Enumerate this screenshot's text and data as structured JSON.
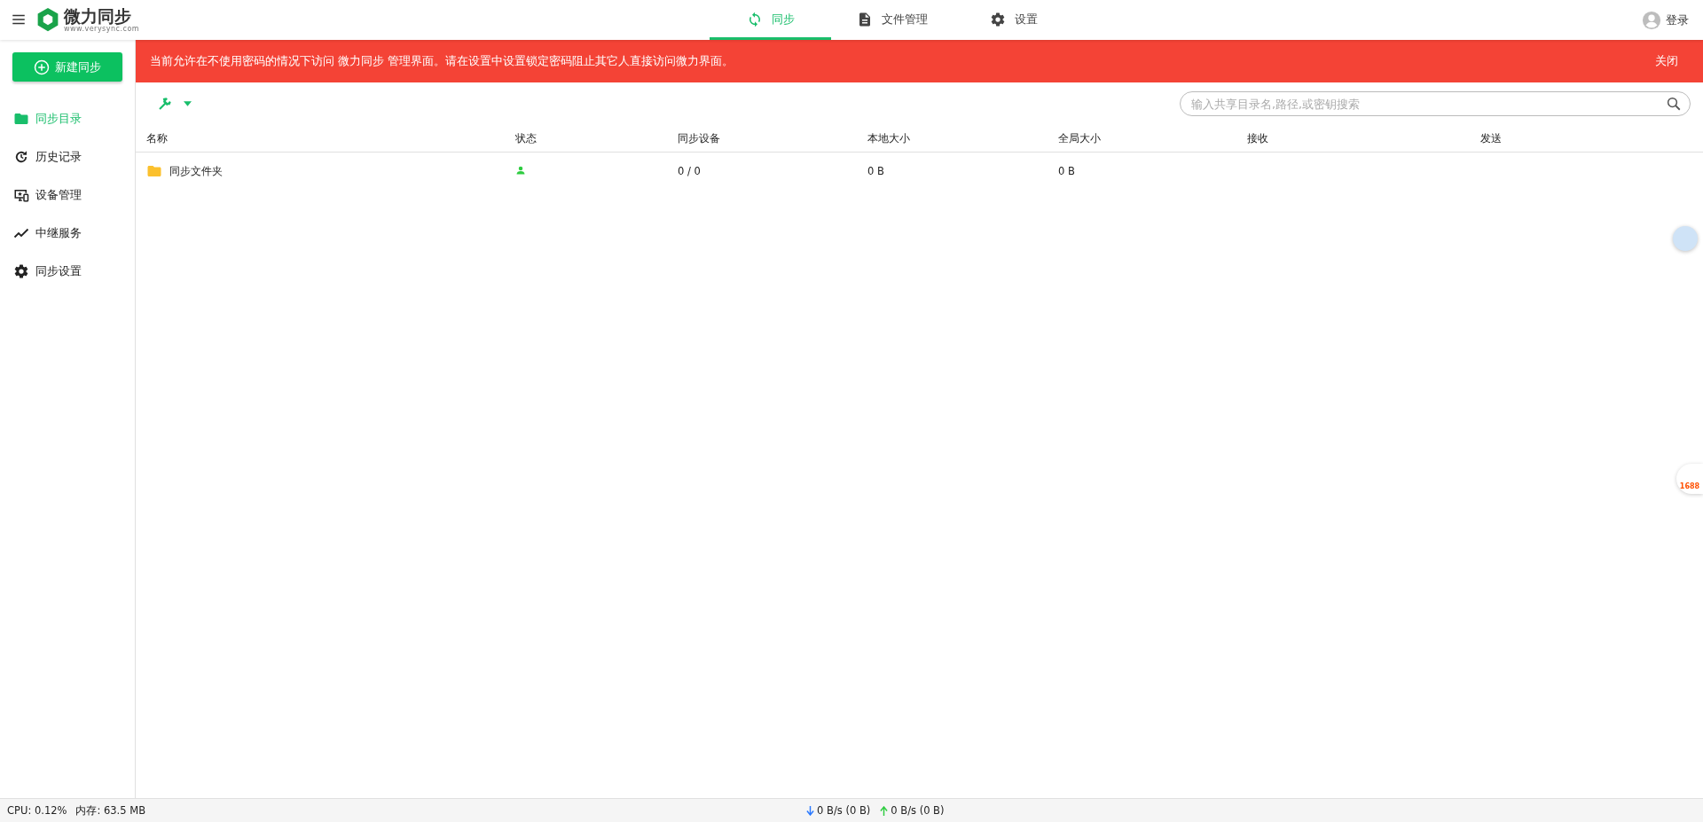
{
  "header": {
    "logo": {
      "name": "微力同步",
      "url": "www.verysync.com"
    },
    "tabs": [
      {
        "label": "同步",
        "selected": true
      },
      {
        "label": "文件管理",
        "selected": false
      },
      {
        "label": "设置",
        "selected": false
      }
    ],
    "login": "登录"
  },
  "sidebar": {
    "new_button": "新建同步",
    "items": [
      {
        "label": "同步目录",
        "selected": true
      },
      {
        "label": "历史记录",
        "selected": false
      },
      {
        "label": "设备管理",
        "selected": false
      },
      {
        "label": "中继服务",
        "selected": false
      },
      {
        "label": "同步设置",
        "selected": false
      }
    ]
  },
  "banner": {
    "message": "当前允许在不使用密码的情况下访问 微力同步 管理界面。请在设置中设置锁定密码阻止其它人直接访问微力界面。",
    "close": "关闭"
  },
  "search": {
    "placeholder": "输入共享目录名,路径,或密钥搜索"
  },
  "table": {
    "columns": [
      "名称",
      "状态",
      "同步设备",
      "本地大小",
      "全局大小",
      "接收",
      "发送"
    ],
    "rows": [
      {
        "name": "同步文件夹",
        "online": true,
        "devices": "0 / 0",
        "local_size": "0 B",
        "global_size": "0 B"
      }
    ]
  },
  "floating": {
    "badge": "1688"
  },
  "status_bar": {
    "cpu": "CPU: 0.12%",
    "memory": "内存: 63.5 MB",
    "download": "0 B/s (0 B)",
    "upload": "0 B/s (0 B)"
  }
}
